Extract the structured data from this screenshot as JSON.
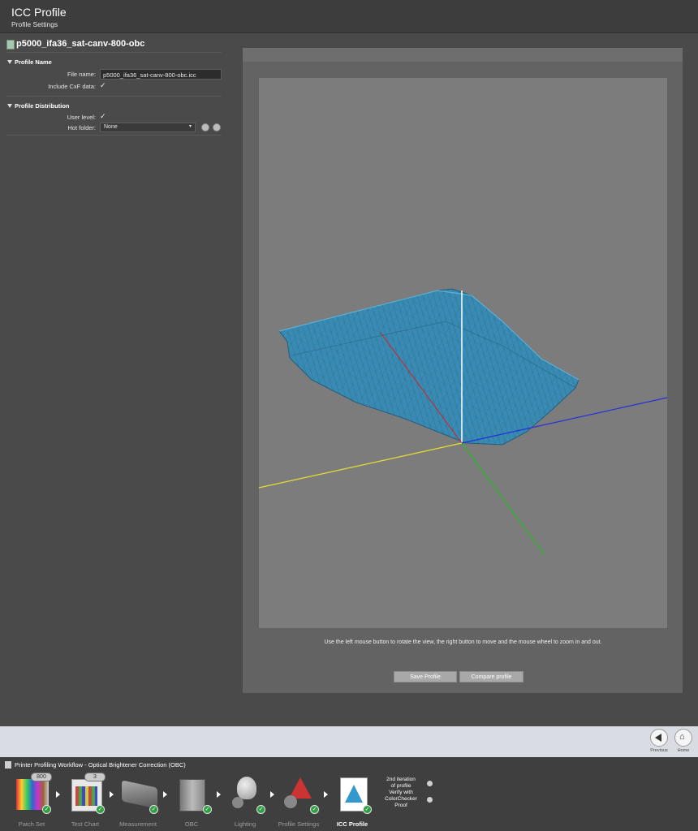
{
  "header": {
    "title": "ICC Profile",
    "subtitle": "Profile Settings"
  },
  "profile": {
    "name": "p5000_ifa36_sat-canv-800-obc",
    "section_name": "Profile Name",
    "file_name_label": "File name:",
    "file_name_value": "p5000_ifa36_sat-canv-800-obc.icc",
    "cxf_label": "Include CxF data:",
    "cxf_checked": "✓",
    "section_distribution": "Profile Distribution",
    "user_level_label": "User level:",
    "user_level_checked": "✓",
    "hot_folder_label": "Hot folder:",
    "hot_folder_value": "None"
  },
  "viewer": {
    "hint": "Use the left mouse button to rotate the view, the right button to move and the mouse wheel to zoom in and out.",
    "save_label": "Save Profile",
    "compare_label": "Compare profile"
  },
  "nav": {
    "previous_label": "Previous",
    "home_label": "Home"
  },
  "workflow": {
    "title": "Printer Profiling Workflow - Optical Brightener Correction (OBC)",
    "patch_count": "800",
    "chart_count": "3",
    "steps": [
      {
        "label": "Patch Set",
        "icon": "patch-set-icon"
      },
      {
        "label": "Test Chart",
        "icon": "test-chart-icon"
      },
      {
        "label": "Measurement",
        "icon": "measurement-icon"
      },
      {
        "label": "OBC",
        "icon": "obc-icon"
      },
      {
        "label": "Lighting",
        "icon": "lighting-icon"
      },
      {
        "label": "Profile Settings",
        "icon": "profile-settings-icon"
      },
      {
        "label": "ICC Profile",
        "icon": "icc-profile-icon"
      }
    ],
    "next_line1": "2nd iteration",
    "next_line2": "of profile",
    "next_line3": "Verify with",
    "next_line4": "ColorChecker",
    "next_line5": "Proof"
  },
  "colors": {
    "gamut": "#3a8bb3",
    "axis_l": "#ffffff",
    "axis_a_pos": "#c0303a",
    "axis_a_neg": "#22c022",
    "axis_b_pos": "#2430d8",
    "axis_b_neg": "#e8e030"
  }
}
